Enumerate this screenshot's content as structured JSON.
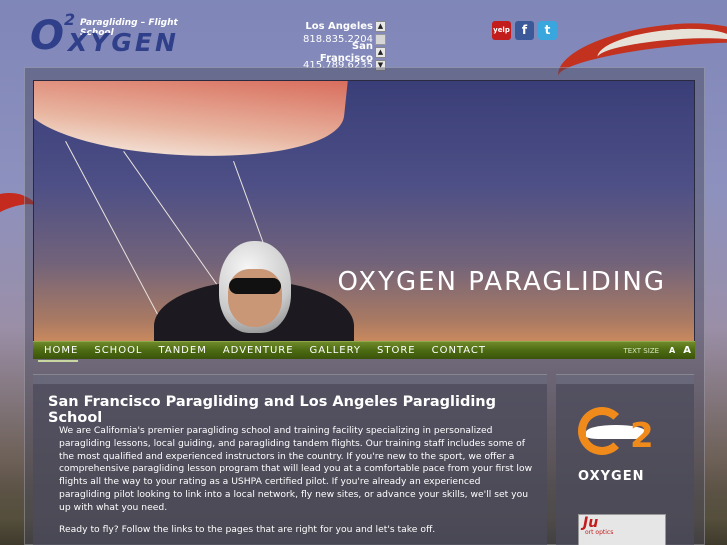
{
  "brand": {
    "logo_letter": "O",
    "logo_superscript": "2",
    "logo_word": "XYGEN",
    "tagline": "Paragliding – Flight School"
  },
  "contact": {
    "locations": [
      {
        "city": "Los Angeles",
        "phone": "818.835.2204"
      },
      {
        "city": "San Francisco",
        "phone": "415.789.6235"
      }
    ]
  },
  "social": {
    "yelp_label": "yelp",
    "facebook_label": "f",
    "twitter_label": "t"
  },
  "hero": {
    "title": "OXYGEN PARAGLIDING"
  },
  "nav": {
    "items": [
      "HOME",
      "SCHOOL",
      "TANDEM",
      "ADVENTURE",
      "GALLERY",
      "STORE",
      "CONTACT"
    ],
    "text_size_label": "TEXT SIZE",
    "size_small": "A",
    "size_large": "A"
  },
  "main": {
    "title": "San Francisco Paragliding and Los Angeles Paragliding School",
    "paragraphs": [
      "We are California's premier paragliding school and training facility specializing in personalized paragliding lessons, local guiding, and paragliding tandem flights. Our training staff includes some of the most qualified and experienced instructors in the country. If you're new to the sport, we offer a comprehensive paragliding lesson program that will lead you at a comfortable pace from your first low flights all the way to your rating as a USHPA certified pilot. If you're already an experienced paragliding pilot looking to link into a local network, fly new sites, or advance your skills, we'll set you up with what you need.",
      "Ready to fly? Follow the links to the pages that are right for you and let's take off."
    ]
  },
  "sidebar": {
    "logo_two": "2",
    "logo_word": "OXYGEN",
    "ad_text": "Ju",
    "ad_sub": "ort optics"
  },
  "colors": {
    "nav_green": "#4c6a12",
    "brand_blue": "#2f3f8a",
    "brand_orange": "#f08a1a",
    "canopy_red": "#c42a1e"
  }
}
